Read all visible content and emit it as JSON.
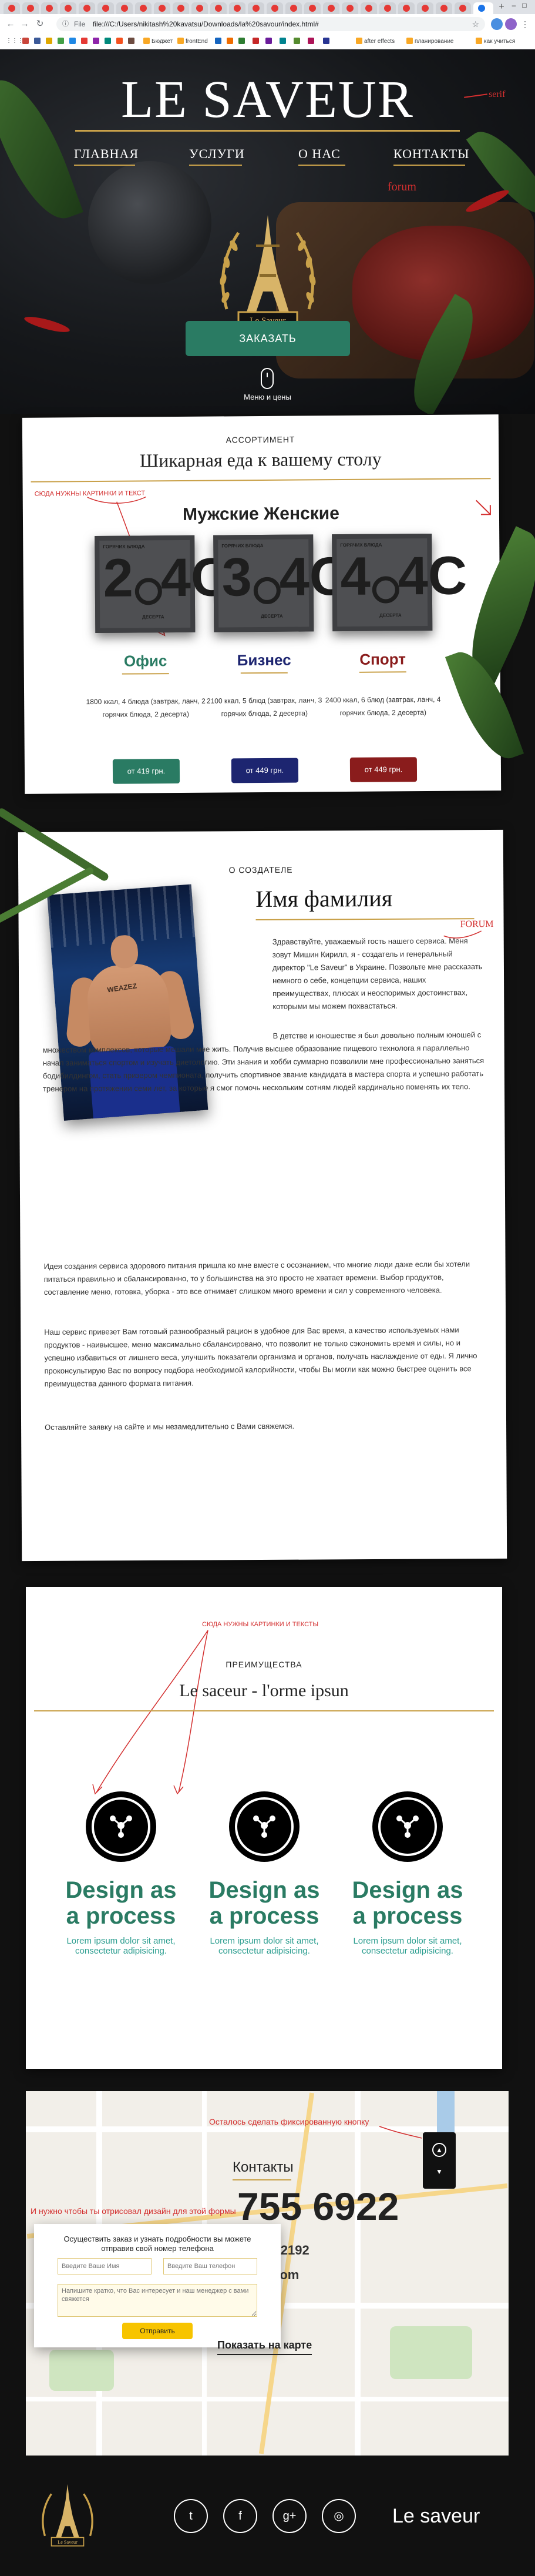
{
  "browser": {
    "url": "file:///C:/Users/nikitash%20kavatsu/Downloads/la%20savour/index.html#",
    "url_scheme": "File",
    "bookmarks": [
      "Бюджет",
      "frontEnd",
      "after effects",
      "планирование",
      "как учиться"
    ]
  },
  "hero": {
    "logo": "LE SAVEUR",
    "note_serif": "serif",
    "nav": [
      "ГЛАВНАЯ",
      "УСЛУГИ",
      "О НАС",
      "КОНТАКТЫ"
    ],
    "note_forum": "forum",
    "emblem_text": "Le Saveur",
    "order_button": "ЗАКАЗАТЬ",
    "scroll_label": "Меню и цены"
  },
  "assortment": {
    "eyebrow": "АССОРТИМЕНТ",
    "title": "Шикарная еда к вашему столу",
    "note_images": "СЮДА НУЖНЫ КАРТИНКИ И ТЕКСТ",
    "gender_title": "Мужские Женские",
    "plans": [
      {
        "name": "Офис",
        "color": "#2a7b63",
        "digit_main": "2",
        "digit_right": "4C",
        "top_text": "ГОРЯЧИХ БЛЮДА",
        "tag": "ДЕСЕРТА",
        "description": "1800 ккал, 4 блюда (завтрак, ланч, 2 горячих блюда, 2 десерта)",
        "price": "от 419 грн."
      },
      {
        "name": "Бизнес",
        "color": "#1d2570",
        "digit_main": "3",
        "digit_right": "4C",
        "top_text": "ГОРЯЧИХ БЛЮДА",
        "tag": "ДЕСЕРТА",
        "description": "2100 ккал, 5 блюд (завтрак, ланч, 3 горячих блюда, 2 десерта)",
        "price": "от 449 грн."
      },
      {
        "name": "Спорт",
        "color": "#8a1c1c",
        "digit_main": "4",
        "digit_right": "4C",
        "top_text": "ГОРЯЧИХ БЛЮДА",
        "tag": "ДЕСЕРТА",
        "description": "2400 ккал, 6 блюд (завтрак, ланч, 4 горячих блюда, 2 десерта)",
        "price": "от 449 грн."
      }
    ]
  },
  "about": {
    "eyebrow": "О СОЗДАТЕЛЕ",
    "name": "Имя фамилия",
    "note_forum": "FORUM",
    "photo_tattoo": "WEAZEZ",
    "paragraphs": [
      "Здравствуйте, уважаемый гость нашего сервиса. Меня зовут Мишин Кирилл, я - создатель и генеральный директор \"Le Saveur\" в Украине. Позвольте мне рассказать немного о себе, концепции сервиса, наших преимуществах, плюсах и неоспоримых достоинствах, которыми мы можем похвастаться.",
      "В детстве и юношестве я был довольно полным юношей с множеством комплексов, которые мешали мне жить. Получив высшее образование пищевого технолога я параллельно начал заниматься спортом и изучать диетологию. Эти знания и хобби суммарно позволили мне профессионально заняться бодибилдингом, стать призером чемпионата, получить спортивное звание кандидата в мастера спорта и успешно работать тренером на протяжении семи лет, за которые я смог помочь нескольким сотням людей кардинально поменять их тело.",
      "Идея создания сервиса здорового питания пришла ко мне вместе с осознанием, что многие люди даже если бы хотели питаться правильно и сбалансированно, то у большинства на это просто не хватает времени. Выбор продуктов, составление меню, готовка, уборка - это все отнимает слишком много времени и сил у современного человека.",
      "Наш сервис привезет Вам готовый разнообразный рацион в удобное для Вас время, а качество используемых нами продуктов - наивысшее, меню максимально сбалансировано, что позволит не только сэкономить время и силы, но и успешно избавиться от лишнего веса, улучшить показатели организма и органов, получать наслаждение от еды. Я лично проконсультирую Вас по вопросу подбора необходимой калорийности, чтобы Вы могли как можно быстрее оценить все преимущества данного формата питания.",
      "Оставляйте заявку на сайте и мы незамедлительно с Вами свяжемся."
    ]
  },
  "advantages": {
    "note_images": "СЮДА НУЖНЫ КАРТИНКИ И ТЕКСТЫ",
    "eyebrow": "ПРЕИМУЩЕСТВА",
    "title": "Le saceur - l'orme ipsun",
    "items": [
      {
        "heading": "Design as a process",
        "text": "Lorem ipsum dolor sit amet, consectetur adipisicing."
      },
      {
        "heading": "Design as a process",
        "text": "Lorem ipsum dolor sit amet, consectetur adipisicing."
      },
      {
        "heading": "Design as a process",
        "text": "Lorem ipsum dolor sit amet, consectetur adipisicing."
      }
    ]
  },
  "contacts": {
    "note_fixed_button": "Осталось сделать фиксированную кнопку",
    "note_form": "И нужно чтобы ты отрисовал дизайн для этой формы",
    "title": "Контакты",
    "phone": "755 6922",
    "address": "иев, 02192",
    "email_tail": ".com",
    "map_link": "Показать на карте",
    "form": {
      "title": "Осуществить заказ и узнать подробности вы можете отправив свой номер телефона",
      "name_placeholder": "Введите Ваше Имя",
      "phone_placeholder": "Введите Ваш телефон",
      "message_placeholder": "Напишите кратко, что Вас интересует и наш менеджер с вами свяжется",
      "submit": "Отправить"
    }
  },
  "footer": {
    "brand": "Le saveur",
    "emblem_text": "Le Saveur",
    "social": [
      {
        "icon": "twitter-icon",
        "glyph": "t"
      },
      {
        "icon": "facebook-icon",
        "glyph": "f"
      },
      {
        "icon": "google-plus-icon",
        "glyph": "g+"
      },
      {
        "icon": "instagram-icon",
        "glyph": "◎"
      }
    ]
  },
  "colors": {
    "accent_gold": "#c9a14a",
    "green": "#2a7b63",
    "navy": "#1d2570",
    "burgundy": "#8a1c1c",
    "annotation_red": "#d32f2f"
  }
}
